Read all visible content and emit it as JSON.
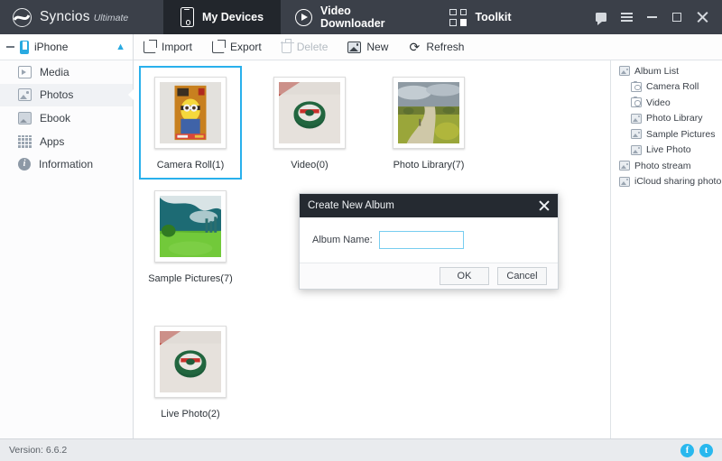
{
  "app": {
    "brand_name": "Syncios",
    "brand_edition": "Ultimate",
    "logo_icon": "syncios-wave-logo"
  },
  "nav_tabs": [
    {
      "label": "My Devices",
      "icon": "phone-icon",
      "active": true
    },
    {
      "label": "Video Downloader",
      "icon": "play-circle-icon",
      "active": false
    },
    {
      "label": "Toolkit",
      "icon": "toolkit-grid-icon",
      "active": false
    }
  ],
  "window_controls": [
    {
      "name": "feedback-bubble-icon",
      "label": ""
    },
    {
      "name": "menu-icon",
      "label": ""
    },
    {
      "name": "minimize-icon",
      "label": ""
    },
    {
      "name": "maximize-icon",
      "label": ""
    },
    {
      "name": "close-icon",
      "label": ""
    }
  ],
  "sidebar": {
    "device": {
      "name": "iPhone",
      "collapse_icon": "minus-icon",
      "device_icon": "phone-icon",
      "eject_icon": "eject-icon"
    },
    "items": [
      {
        "label": "Media",
        "icon": "media-icon",
        "active": false
      },
      {
        "label": "Photos",
        "icon": "photos-icon",
        "active": true
      },
      {
        "label": "Ebook",
        "icon": "ebook-icon",
        "active": false
      },
      {
        "label": "Apps",
        "icon": "apps-grid-icon",
        "active": false
      },
      {
        "label": "Information",
        "icon": "info-icon",
        "active": false
      }
    ]
  },
  "toolbar": {
    "buttons": [
      {
        "label": "Import",
        "icon": "import-icon",
        "disabled": false
      },
      {
        "label": "Export",
        "icon": "export-icon",
        "disabled": false
      },
      {
        "label": "Delete",
        "icon": "trash-icon",
        "disabled": true
      },
      {
        "label": "New",
        "icon": "new-album-icon",
        "disabled": false
      },
      {
        "label": "Refresh",
        "icon": "refresh-icon",
        "disabled": false
      }
    ]
  },
  "albums_grid": [
    {
      "label": "Camera Roll(1)",
      "selected": true,
      "thumb": "minion-phone-case"
    },
    {
      "label": "Video(0)",
      "selected": false,
      "thumb": "tape-roll"
    },
    {
      "label": "Photo Library(7)",
      "selected": false,
      "thumb": "country-road"
    },
    {
      "label": "Sample Pictures(7)",
      "selected": false,
      "thumb": "green-field-sky"
    },
    {
      "label": "Live Photo(2)",
      "selected": false,
      "thumb": "tape-roll"
    }
  ],
  "album_list": {
    "title": "Album List",
    "title_icon": "photos-icon",
    "children": [
      {
        "label": "Camera Roll",
        "icon": "camera-icon"
      },
      {
        "label": "Video",
        "icon": "camera-icon"
      },
      {
        "label": "Photo Library",
        "icon": "photos-icon"
      },
      {
        "label": "Sample Pictures",
        "icon": "photos-icon"
      },
      {
        "label": "Live Photo",
        "icon": "photos-icon"
      }
    ],
    "roots": [
      {
        "label": "Photo stream",
        "icon": "photos-icon"
      },
      {
        "label": "iCloud sharing photo",
        "icon": "photos-icon"
      }
    ]
  },
  "dialog": {
    "title": "Create New Album",
    "close_icon": "close-icon",
    "field_label": "Album Name:",
    "field_value": "",
    "field_placeholder": "",
    "ok_label": "OK",
    "cancel_label": "Cancel"
  },
  "statusbar": {
    "version": "Version: 6.6.2",
    "socials": [
      {
        "name": "facebook-icon",
        "glyph": "f"
      },
      {
        "name": "twitter-icon",
        "glyph": "t"
      }
    ]
  },
  "colors": {
    "titlebar": "#3b4049",
    "active_tab": "#22262c",
    "accent": "#29b0ec",
    "dialog_header": "#252a31",
    "statusbar": "#e9ebee"
  }
}
